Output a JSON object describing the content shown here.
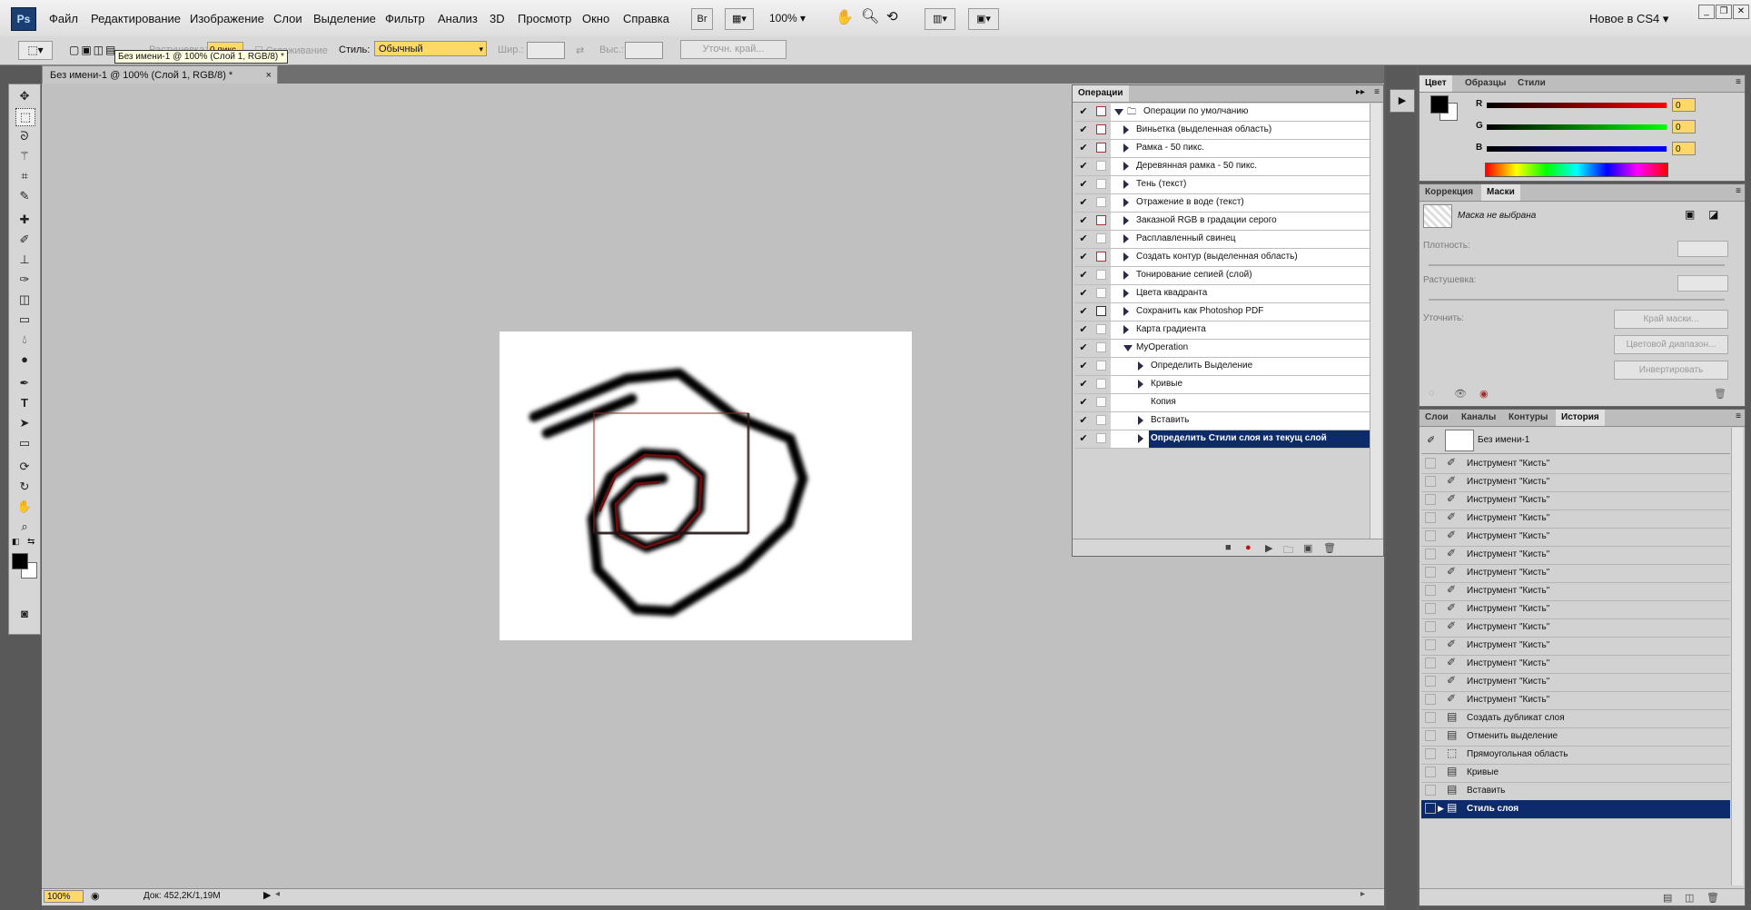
{
  "app": {
    "logo": "Ps",
    "workspace": "Новое в CS4"
  },
  "menu": [
    "Файл",
    "Редактирование",
    "Изображение",
    "Слои",
    "Выделение",
    "Фильтр",
    "Анализ",
    "3D",
    "Просмотр",
    "Окно",
    "Справка"
  ],
  "menubar": {
    "bridge": "Br",
    "zoom": "100%"
  },
  "options": {
    "feather_label": "Растушевка:",
    "feather_value": "0 пикс",
    "antialias_label": "Сглаживание",
    "style_label": "Стиль:",
    "style_value": "Обычный",
    "width_label": "Шир.:",
    "height_label": "Выс.:",
    "refine_label": "Уточн. край..."
  },
  "tooltip": "Без имени-1 @ 100% (Слой 1, RGB/8) *",
  "document": {
    "tab_title": "Без имени-1 @ 100% (Слой 1, RGB/8) *",
    "close": "×"
  },
  "status": {
    "zoom": "100%",
    "doc_info": "Док: 452,2K/1,19M"
  },
  "actions": {
    "tab": "Операции",
    "rows": [
      {
        "label": "Операции по умолчанию",
        "modal": "on",
        "indent": 0,
        "kind": "set"
      },
      {
        "label": "Виньетка (выделенная область)",
        "modal": "on",
        "indent": 1
      },
      {
        "label": "Рамка - 50 пикс.",
        "modal": "on",
        "indent": 1
      },
      {
        "label": "Деревянная рамка - 50 пикс.",
        "modal": "off",
        "indent": 1
      },
      {
        "label": "Тень (текст)",
        "modal": "off",
        "indent": 1
      },
      {
        "label": "Отражение в воде (текст)",
        "modal": "off",
        "indent": 1
      },
      {
        "label": "Заказной RGB в градации серого",
        "modal": "on",
        "indent": 1
      },
      {
        "label": "Расплавленный свинец",
        "modal": "off",
        "indent": 1
      },
      {
        "label": "Создать контур (выделенная область)",
        "modal": "on",
        "indent": 1
      },
      {
        "label": "Тонирование сепией (слой)",
        "modal": "off",
        "indent": 1
      },
      {
        "label": "Цвета квадранта",
        "modal": "off",
        "indent": 1
      },
      {
        "label": "Сохранить как Photoshop PDF",
        "modal": "dark",
        "indent": 1
      },
      {
        "label": "Карта градиента",
        "modal": "off",
        "indent": 1
      },
      {
        "label": "MyOperation",
        "modal": "off",
        "indent": 1,
        "kind": "open"
      },
      {
        "label": "Определить Выделение",
        "modal": "off",
        "indent": 2
      },
      {
        "label": "Кривые",
        "modal": "off",
        "indent": 2
      },
      {
        "label": "Копия",
        "modal": "off",
        "indent": 2,
        "kind": "leaf"
      },
      {
        "label": "Вставить",
        "modal": "off",
        "indent": 2
      },
      {
        "label": "Определить Стили слоя из текущ слой",
        "modal": "off",
        "indent": 2,
        "selected": true
      }
    ]
  },
  "color": {
    "tabs": [
      "Цвет",
      "Образцы",
      "Стили"
    ],
    "channels": [
      {
        "name": "R",
        "value": "0",
        "color": "#d01010"
      },
      {
        "name": "G",
        "value": "0",
        "color": "#10b010"
      },
      {
        "name": "B",
        "value": "0",
        "color": "#1010d0"
      }
    ]
  },
  "masks": {
    "tabs": [
      "Коррекция",
      "Маски"
    ],
    "title": "Маска не выбрана",
    "density_label": "Плотность:",
    "feather_label": "Растушевка:",
    "refine_label": "Уточнить:",
    "btn_edge": "Край маски...",
    "btn_range": "Цветовой диапазон...",
    "btn_invert": "Инвертировать"
  },
  "history": {
    "tabs": [
      "Слои",
      "Каналы",
      "Контуры",
      "История"
    ],
    "snapshot": "Без имени-1",
    "items": [
      {
        "label": "Инструмент \"Кисть\"",
        "icon": "brush-icon"
      },
      {
        "label": "Инструмент \"Кисть\"",
        "icon": "brush-icon"
      },
      {
        "label": "Инструмент \"Кисть\"",
        "icon": "brush-icon"
      },
      {
        "label": "Инструмент \"Кисть\"",
        "icon": "brush-icon"
      },
      {
        "label": "Инструмент \"Кисть\"",
        "icon": "brush-icon"
      },
      {
        "label": "Инструмент \"Кисть\"",
        "icon": "brush-icon"
      },
      {
        "label": "Инструмент \"Кисть\"",
        "icon": "brush-icon"
      },
      {
        "label": "Инструмент \"Кисть\"",
        "icon": "brush-icon"
      },
      {
        "label": "Инструмент \"Кисть\"",
        "icon": "brush-icon"
      },
      {
        "label": "Инструмент \"Кисть\"",
        "icon": "brush-icon"
      },
      {
        "label": "Инструмент \"Кисть\"",
        "icon": "brush-icon"
      },
      {
        "label": "Инструмент \"Кисть\"",
        "icon": "brush-icon"
      },
      {
        "label": "Инструмент \"Кисть\"",
        "icon": "brush-icon"
      },
      {
        "label": "Инструмент \"Кисть\"",
        "icon": "brush-icon"
      },
      {
        "label": "Создать дубликат слоя",
        "icon": "document-icon"
      },
      {
        "label": "Отменить выделение",
        "icon": "document-icon"
      },
      {
        "label": "Прямоугольная область",
        "icon": "marquee-icon"
      },
      {
        "label": "Кривые",
        "icon": "document-icon"
      },
      {
        "label": "Вставить",
        "icon": "document-icon"
      },
      {
        "label": "Стиль слоя",
        "icon": "document-icon",
        "selected": true
      }
    ]
  }
}
